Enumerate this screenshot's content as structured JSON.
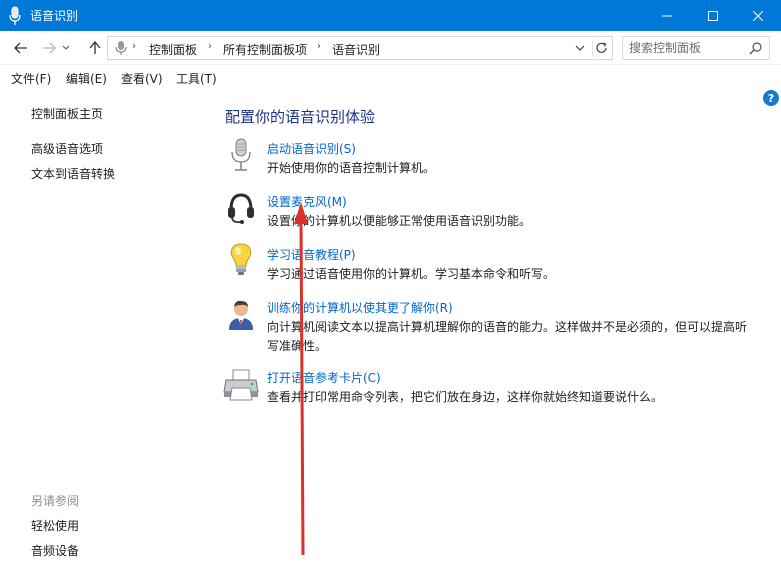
{
  "window": {
    "title": "语音识别",
    "controls": {
      "minimize": "minimize-icon",
      "maximize": "maximize-icon",
      "close": "close-icon"
    }
  },
  "address": {
    "crumbs": [
      "控制面板",
      "所有控制面板项",
      "语音识别"
    ],
    "search_placeholder": "搜索控制面板"
  },
  "menu": [
    "文件(F)",
    "编辑(E)",
    "查看(V)",
    "工具(T)"
  ],
  "help_icon": "?",
  "left_pane": {
    "links": [
      "控制面板主页",
      "高级语音选项",
      "文本到语音转换"
    ],
    "see_also_title": "另请参阅",
    "see_also_links": [
      "轻松使用",
      "音频设备"
    ]
  },
  "main": {
    "heading": "配置你的语音识别体验",
    "tasks": [
      {
        "icon": "microphone-icon",
        "title": "启动语音识别(S)",
        "desc": "开始使用你的语音控制计算机。"
      },
      {
        "icon": "headset-icon",
        "title": "设置麦克风(M)",
        "desc": "设置你的计算机以便能够正常使用语音识别功能。"
      },
      {
        "icon": "lightbulb-icon",
        "title": "学习语音教程(P)",
        "desc": "学习通过语音使用你的计算机。学习基本命令和听写。"
      },
      {
        "icon": "user-training-icon",
        "title": "训练你的计算机以使其更了解你(R)",
        "desc": "向计算机阅读文本以提高计算机理解你的语音的能力。这样做并不是必须的，但可以提高听写准确性。"
      },
      {
        "icon": "printer-icon",
        "title": "打开语音参考卡片(C)",
        "desc": "查看并打印常用命令列表，把它们放在身边，这样你就始终知道要说什么。"
      }
    ]
  },
  "colors": {
    "titlebar": "#0078d7",
    "link": "#0066cc",
    "heading": "#1e3287",
    "annotation": "#d9322a"
  }
}
